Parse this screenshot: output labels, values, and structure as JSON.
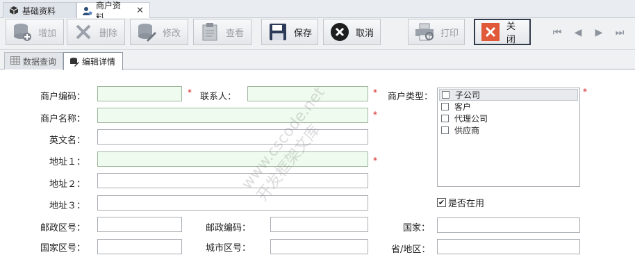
{
  "doc_tabs": [
    {
      "label": "基础资料"
    },
    {
      "label": "商户资料"
    }
  ],
  "toolbar": {
    "add": "增加",
    "delete": "删除",
    "edit": "修改",
    "view": "查看",
    "save": "保存",
    "cancel": "取消",
    "print": "打印",
    "close": "关闭"
  },
  "inner_tabs": [
    {
      "label": "数据查询"
    },
    {
      "label": "编辑详情"
    }
  ],
  "form": {
    "merchant_code": "商户编码：",
    "contact": "联系人：",
    "merchant_type": "商户类型：",
    "merchant_name": "商户名称：",
    "english_name": "英文名：",
    "address1": "地址１：",
    "address2": "地址２：",
    "address3": "地址３：",
    "postal_area": "邮政区号：",
    "postal_code": "邮政编码：",
    "country": "国家：",
    "country_code": "国家区号：",
    "city_code": "城市区号：",
    "province": "省/地区："
  },
  "merchant_types": [
    "子公司",
    "客户",
    "代理公司",
    "供应商"
  ],
  "in_use": {
    "label": "是否在用",
    "checked": true
  },
  "watermark": {
    "line1": "www.cscode.net",
    "line2": "开发框架文库"
  },
  "colors": {
    "required_bg": "#eefbee",
    "required_star": "#d21b1b",
    "close_icon": "#e05a3a"
  }
}
